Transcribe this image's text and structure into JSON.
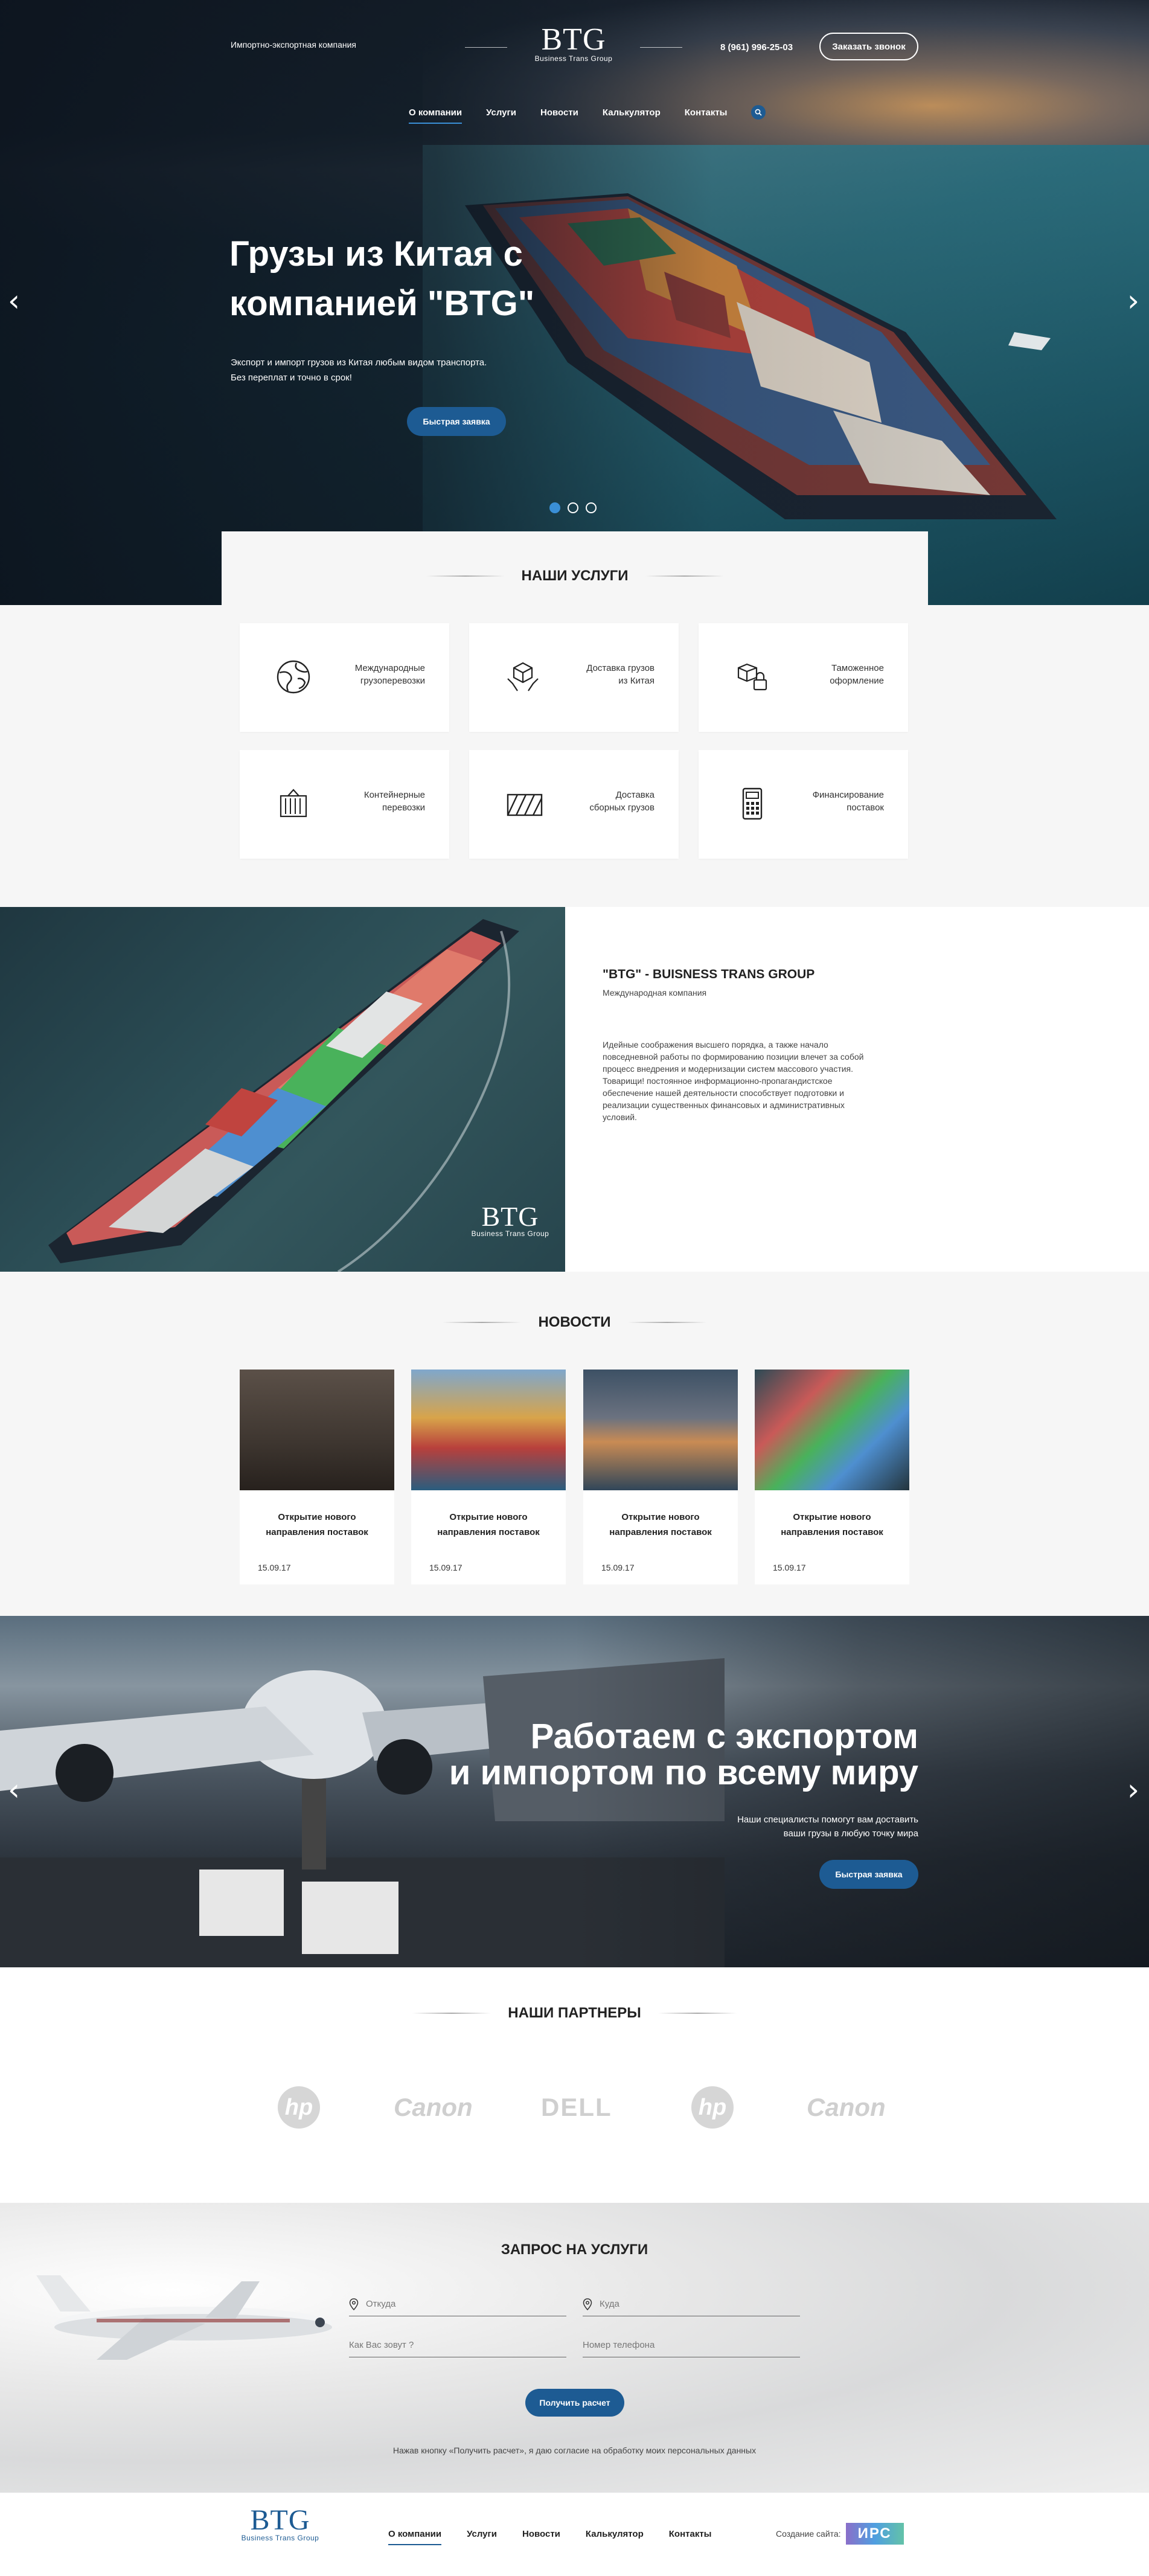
{
  "header": {
    "tagline": "Импортно-экспортная компания",
    "logo_mark": "BTG",
    "logo_sub": "Business Trans Group",
    "phone": "8 (961) 996-25-03",
    "callback_btn": "Заказать звонок",
    "nav": [
      "О компании",
      "Услуги",
      "Новости",
      "Калькулятор",
      "Контакты"
    ],
    "search_icon": "search-icon"
  },
  "hero": {
    "title_line1": "Грузы из Китая с",
    "title_line2": "компанией \"BTG\"",
    "desc_line1": "Экспорт и импорт грузов из Китая любым видом транспорта.",
    "desc_line2": "Без переплат и точно в срок!",
    "cta": "Быстрая заявка",
    "slides_total": 3,
    "active_slide": 1
  },
  "services": {
    "title": "НАШИ УСЛУГИ",
    "items": [
      {
        "line1": "Международные",
        "line2": "грузоперевозки",
        "icon": "globe-icon"
      },
      {
        "line1": "Доставка грузов",
        "line2": "из Китая",
        "icon": "hands-box-icon"
      },
      {
        "line1": "Таможенное",
        "line2": "оформление",
        "icon": "boxes-lock-icon"
      },
      {
        "line1": "Контейнерные",
        "line2": "перевозки",
        "icon": "container-icon"
      },
      {
        "line1": "Доставка",
        "line2": "сборных грузов",
        "icon": "cargo-icon"
      },
      {
        "line1": "Финансирование",
        "line2": "поставок",
        "icon": "calculator-icon"
      }
    ]
  },
  "about": {
    "title": "\"BTG\" - BUISNESS TRANS GROUP",
    "subtitle": "Международная компания",
    "text": "Идейные соображения высшего порядка, а также начало повседневной работы по формированию позиции влечет за собой процесс внедрения и модернизации систем массового участия. Товарищи! постоянное информационно-пропагандистское обеспечение нашей деятельности способствует подготовки и реализации существенных финансовых и административных условий.",
    "logo_mark": "BTG",
    "logo_sub": "Business Trans Group"
  },
  "news": {
    "title": "НОВОСТИ",
    "items": [
      {
        "title_line1": "Открытие нового",
        "title_line2": "направления поставок",
        "date": "15.09.17"
      },
      {
        "title_line1": "Открытие нового",
        "title_line2": "направления поставок",
        "date": "15.09.17"
      },
      {
        "title_line1": "Открытие нового",
        "title_line2": "направления поставок",
        "date": "15.09.17"
      },
      {
        "title_line1": "Открытие нового",
        "title_line2": "направления поставок",
        "date": "15.09.17"
      }
    ]
  },
  "banner": {
    "title_line1": "Работаем с экспортом",
    "title_line2": "и импортом по всему миру",
    "desc_line1": "Наши специалисты помогут вам доставить",
    "desc_line2": "ваши грузы в любую точку мира",
    "cta": "Быстрая заявка"
  },
  "partners": {
    "title": "НАШИ ПАРТНЕРЫ",
    "items": [
      "hp",
      "Canon",
      "DELL",
      "hp",
      "Canon"
    ]
  },
  "request": {
    "title": "ЗАПРОС НА УСЛУГИ",
    "from_placeholder": "Откуда",
    "to_placeholder": "Куда",
    "name_placeholder": "Как Вас зовут ?",
    "phone_placeholder": "Номер телефона",
    "submit": "Получить расчет",
    "consent": "Нажав кнопку «Получить расчет», я даю согласие на обработку моих персональных данных"
  },
  "footer": {
    "logo_mark": "BTG",
    "logo_sub": "Business Trans Group",
    "nav": [
      "О компании",
      "Услуги",
      "Новости",
      "Калькулятор",
      "Контакты"
    ],
    "credit_label": "Создание сайта:",
    "credit_brand": "ИРС"
  },
  "colors": {
    "accent": "#1d5b93",
    "link_active": "#3a8fd6",
    "bg_light": "#f6f6f6"
  }
}
